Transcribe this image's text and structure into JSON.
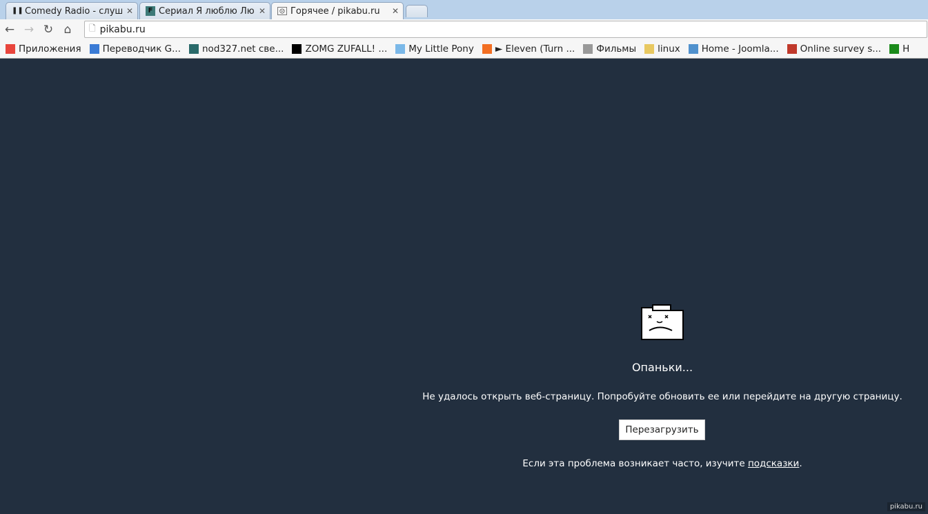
{
  "tabs": [
    {
      "title": "Comedy Radio - слушать",
      "icon": "pause-icon",
      "active": false
    },
    {
      "title": "Сериал Я люблю Люси",
      "icon": "f-favicon",
      "active": false
    },
    {
      "title": "Горячее / pikabu.ru",
      "icon": "sad-page-icon",
      "active": true
    }
  ],
  "toolbar": {
    "url": "pikabu.ru"
  },
  "bookmarks": [
    {
      "label": "Приложения",
      "icon": "apps-grid-icon",
      "color": "#e8453c"
    },
    {
      "label": "Переводчик G...",
      "icon": "translate-icon",
      "color": "#3a7bd5"
    },
    {
      "label": "nod327.net све...",
      "icon": "seven-icon",
      "color": "#2a6a6a"
    },
    {
      "label": "ZOMG ZUFALL! ...",
      "icon": "z0r-icon",
      "color": "#000000"
    },
    {
      "label": "My Little Pony",
      "icon": "heart-icon",
      "color": "#7ab8e8"
    },
    {
      "label": "► Eleven (Turn ...",
      "icon": "soundcloud-icon",
      "color": "#f26f23"
    },
    {
      "label": "Фильмы",
      "icon": "gear-icon",
      "color": "#999999"
    },
    {
      "label": "linux",
      "icon": "folder-icon",
      "color": "#e8c860"
    },
    {
      "label": "Home - Joomla...",
      "icon": "joomla-icon",
      "color": "#5091cd"
    },
    {
      "label": "Online survey s...",
      "icon": "target-icon",
      "color": "#c0392b"
    },
    {
      "label": "H",
      "icon": "y-icon",
      "color": "#1a8a1a"
    }
  ],
  "error": {
    "heading": "Опаньки...",
    "message": "Не удалось открыть веб-страницу. Попробуйте обновить ее или перейдите на другую страницу.",
    "reload_label": "Перезагрузить",
    "hint_prefix": "Если эта проблема возникает часто, изучите ",
    "hint_link": "подсказки",
    "hint_suffix": "."
  },
  "watermark": "pikabu.ru",
  "colors": {
    "page_bg": "#222f3f"
  }
}
